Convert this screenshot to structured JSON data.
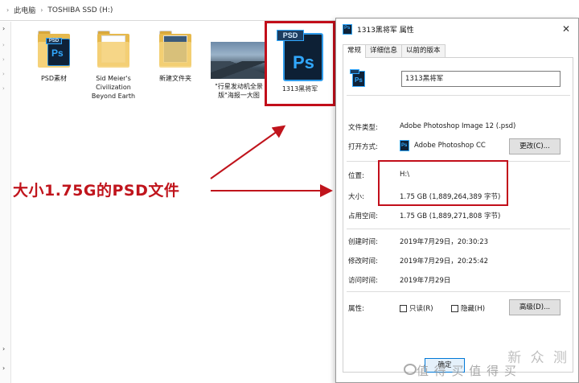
{
  "explorer": {
    "breadcrumb": [
      "此电脑",
      "TOSHIBA SSD (H:)"
    ],
    "files": [
      {
        "label": "PSD素材",
        "type": "folder-psd"
      },
      {
        "label": "Sid Meier's Civilization Beyond Earth",
        "type": "folder"
      },
      {
        "label": "新建文件夹",
        "type": "folder"
      },
      {
        "label": "\"行星发动机全景版\"海报一大图",
        "type": "image"
      },
      {
        "label": "1313黑将军",
        "type": "psd"
      }
    ],
    "psd_badge": "PSD",
    "ps_glyph": "Ps"
  },
  "annotation": {
    "text": "大小1.75G的PSD文件",
    "color": "#c0141c"
  },
  "dialog": {
    "title": "1313黑将军 属性",
    "close_glyph": "✕",
    "tabs": [
      "常规",
      "详细信息",
      "以前的版本"
    ],
    "active_tab": 0,
    "file_name": "1313黑将军",
    "file_type_label": "文件类型:",
    "file_type_value": "Adobe Photoshop Image 12 (.psd)",
    "open_with_label": "打开方式:",
    "open_with_value": "Adobe Photoshop CC",
    "change_button": "更改(C)...",
    "location_label": "位置:",
    "location_value": "H:\\",
    "size_label": "大小:",
    "size_value": "1.75 GB (1,889,264,389 字节)",
    "disk_size_label": "占用空间:",
    "disk_size_value": "1.75 GB (1,889,271,808 字节)",
    "created_label": "创建时间:",
    "created_value": "2019年7月29日，20:30:23",
    "modified_label": "修改时间:",
    "modified_value": "2019年7月29日，20:25:42",
    "accessed_label": "访问时间:",
    "accessed_value": "2019年7月29日",
    "attributes_label": "属性:",
    "readonly_label": "只读(R)",
    "hidden_label": "隐藏(H)",
    "advanced_button": "高级(D)...",
    "ok_button": "确定"
  },
  "watermark": {
    "line1": "新 众 测",
    "line2": "值 得 买 值 得 买"
  },
  "colors": {
    "highlight_red": "#c20e1a",
    "ps_blue": "#31a8ff",
    "ps_dark": "#0f2238",
    "folder_yellow": "#f5d27a"
  }
}
